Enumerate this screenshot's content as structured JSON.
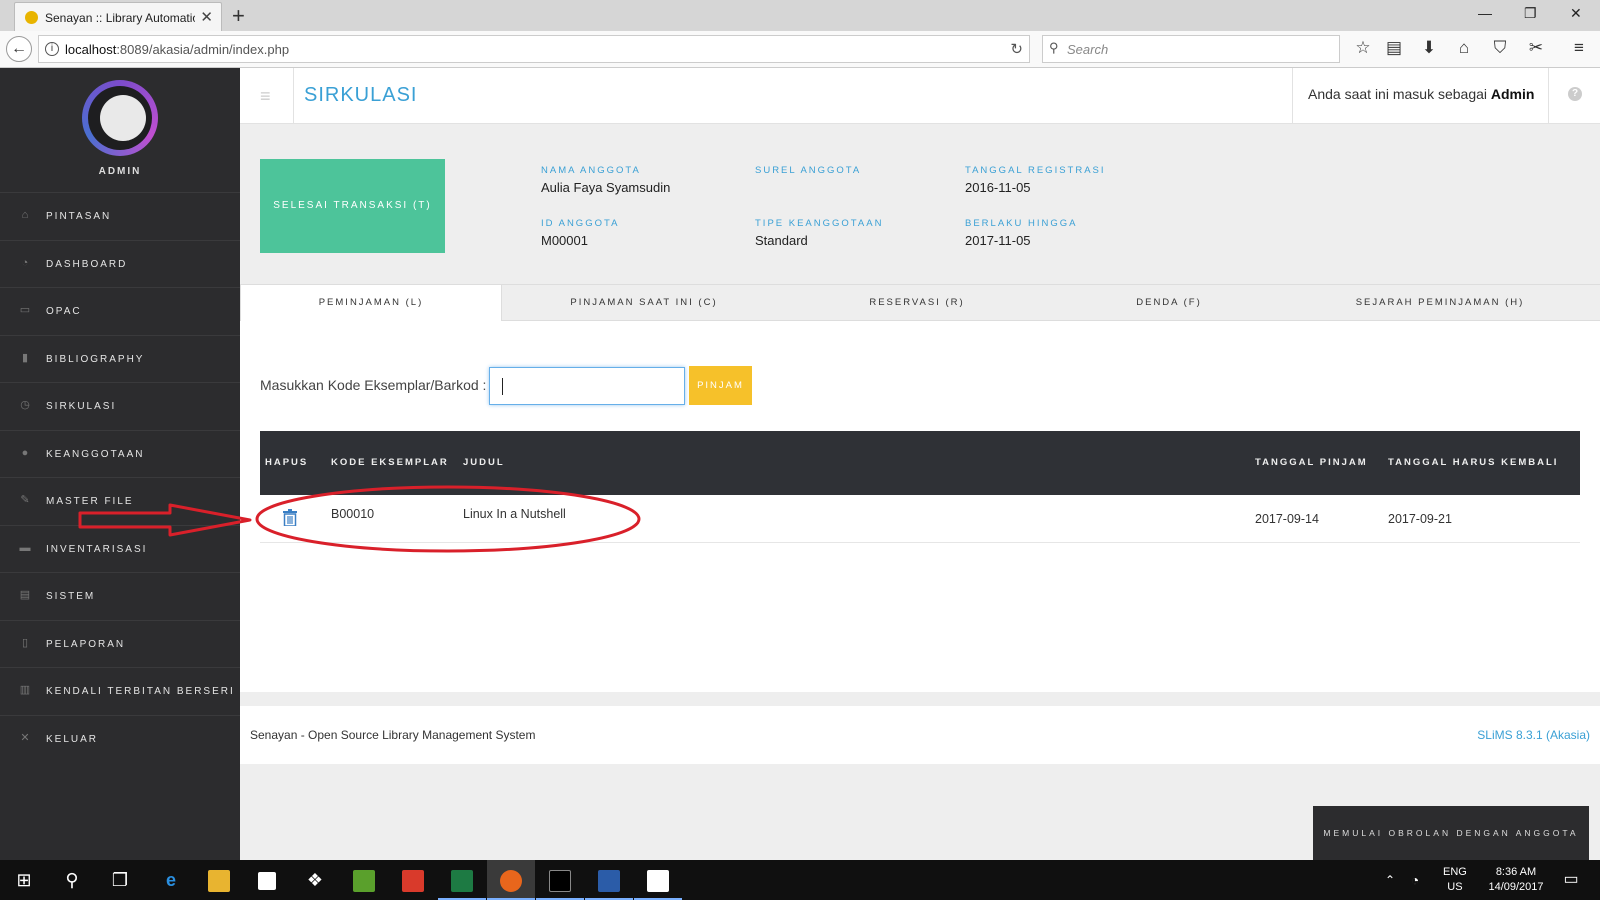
{
  "browser": {
    "tab_title": "Senayan :: Library Automation",
    "url_host": "localhost",
    "url_rest": ":8089/akasia/admin/index.php",
    "search_placeholder": "Search"
  },
  "sidebar": {
    "user_label": "ADMIN",
    "items": [
      {
        "label": "PINTASAN",
        "icon": "home-icon"
      },
      {
        "label": "DASHBOARD",
        "icon": "dashboard-icon"
      },
      {
        "label": "OPAC",
        "icon": "monitor-icon"
      },
      {
        "label": "BIBLIOGRAPHY",
        "icon": "bookmark-icon"
      },
      {
        "label": "SIRKULASI",
        "icon": "clock-icon"
      },
      {
        "label": "KEANGGOTAAN",
        "icon": "user-icon"
      },
      {
        "label": "MASTER FILE",
        "icon": "pencil-icon"
      },
      {
        "label": "INVENTARISASI",
        "icon": "briefcase-icon"
      },
      {
        "label": "SISTEM",
        "icon": "keyboard-icon"
      },
      {
        "label": "PELAPORAN",
        "icon": "document-icon"
      },
      {
        "label": "KENDALI TERBITAN BERSERI",
        "icon": "barcode-icon"
      },
      {
        "label": "KELUAR",
        "icon": "close-icon"
      }
    ]
  },
  "header": {
    "title": "SIRKULASI",
    "login_prefix": "Anda saat ini masuk sebagai",
    "login_user": "Admin"
  },
  "member": {
    "finish_button": "SELESAI TRANSAKSI (T)",
    "name_label": "NAMA ANGGOTA",
    "name": "Aulia Faya Syamsudin",
    "email_label": "SUREL ANGGOTA",
    "email": "",
    "reg_label": "TANGGAL REGISTRASI",
    "reg_date": "2016-11-05",
    "id_label": "ID ANGGOTA",
    "id": "M00001",
    "type_label": "TIPE KEANGGOTAAN",
    "type": "Standard",
    "expiry_label": "BERLAKU HINGGA",
    "expiry": "2017-11-05"
  },
  "tabs": [
    "PEMINJAMAN (L)",
    "PINJAMAN SAAT INI (C)",
    "RESERVASI (R)",
    "DENDA (F)",
    "SEJARAH PEMINJAMAN (H)"
  ],
  "loan_form": {
    "label": "Masukkan Kode Eksemplar/Barkod :",
    "input_value": "",
    "button": "PINJAM"
  },
  "loan_table": {
    "columns": [
      "HAPUS",
      "KODE EKSEMPLAR",
      "JUDUL",
      "TANGGAL PINJAM",
      "TANGGAL HARUS KEMBALI"
    ],
    "rows": [
      {
        "code": "B00010",
        "title": "Linux In a Nutshell",
        "loan_date": "2017-09-14",
        "due_date": "2017-09-21"
      }
    ]
  },
  "footer": {
    "left": "Senayan - Open Source Library Management System",
    "right": "SLiMS 8.3.1 (Akasia)",
    "chat_button": "MEMULAI OBROLAN DENGAN ANGGOTA"
  },
  "taskbar": {
    "lang_1": "ENG",
    "lang_2": "US",
    "time": "8:36 AM",
    "date": "14/09/2017"
  },
  "colors": {
    "accent": "#3aa0d5",
    "finish_green": "#4dc49a",
    "pinjam_yellow": "#f6c12a",
    "annotation_red": "#d9202a"
  }
}
